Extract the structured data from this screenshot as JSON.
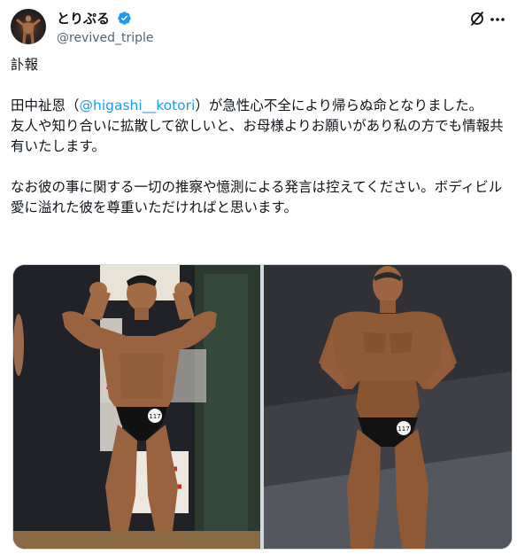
{
  "author": {
    "display_name": "とりぷる",
    "handle": "@revived_triple"
  },
  "tweet": {
    "line1": "訃報",
    "line2_pre": "田中祉恩（",
    "mention": "@higashi__kotori",
    "line2_post": "）が急性心不全により帰らぬ命となりました。",
    "line3": "友人や知り合いに拡散して欲しいと、お母様よりお願いがあり私の方でも情報共有いたします。",
    "line4": "なお彼の事に関する一切の推察や憶測による発言は控えてください。ボディビル愛に溢れた彼を尊重いただければと思います。"
  },
  "icons": {
    "verified": "verified-badge-icon",
    "grok": "grok-icon",
    "more": "more-icon"
  },
  "media": {
    "photo1_badge": "117",
    "photo2_badge": "117"
  },
  "colors": {
    "accent": "#1d9bf0",
    "secondary_text": "#536471",
    "text": "#0f1419"
  }
}
